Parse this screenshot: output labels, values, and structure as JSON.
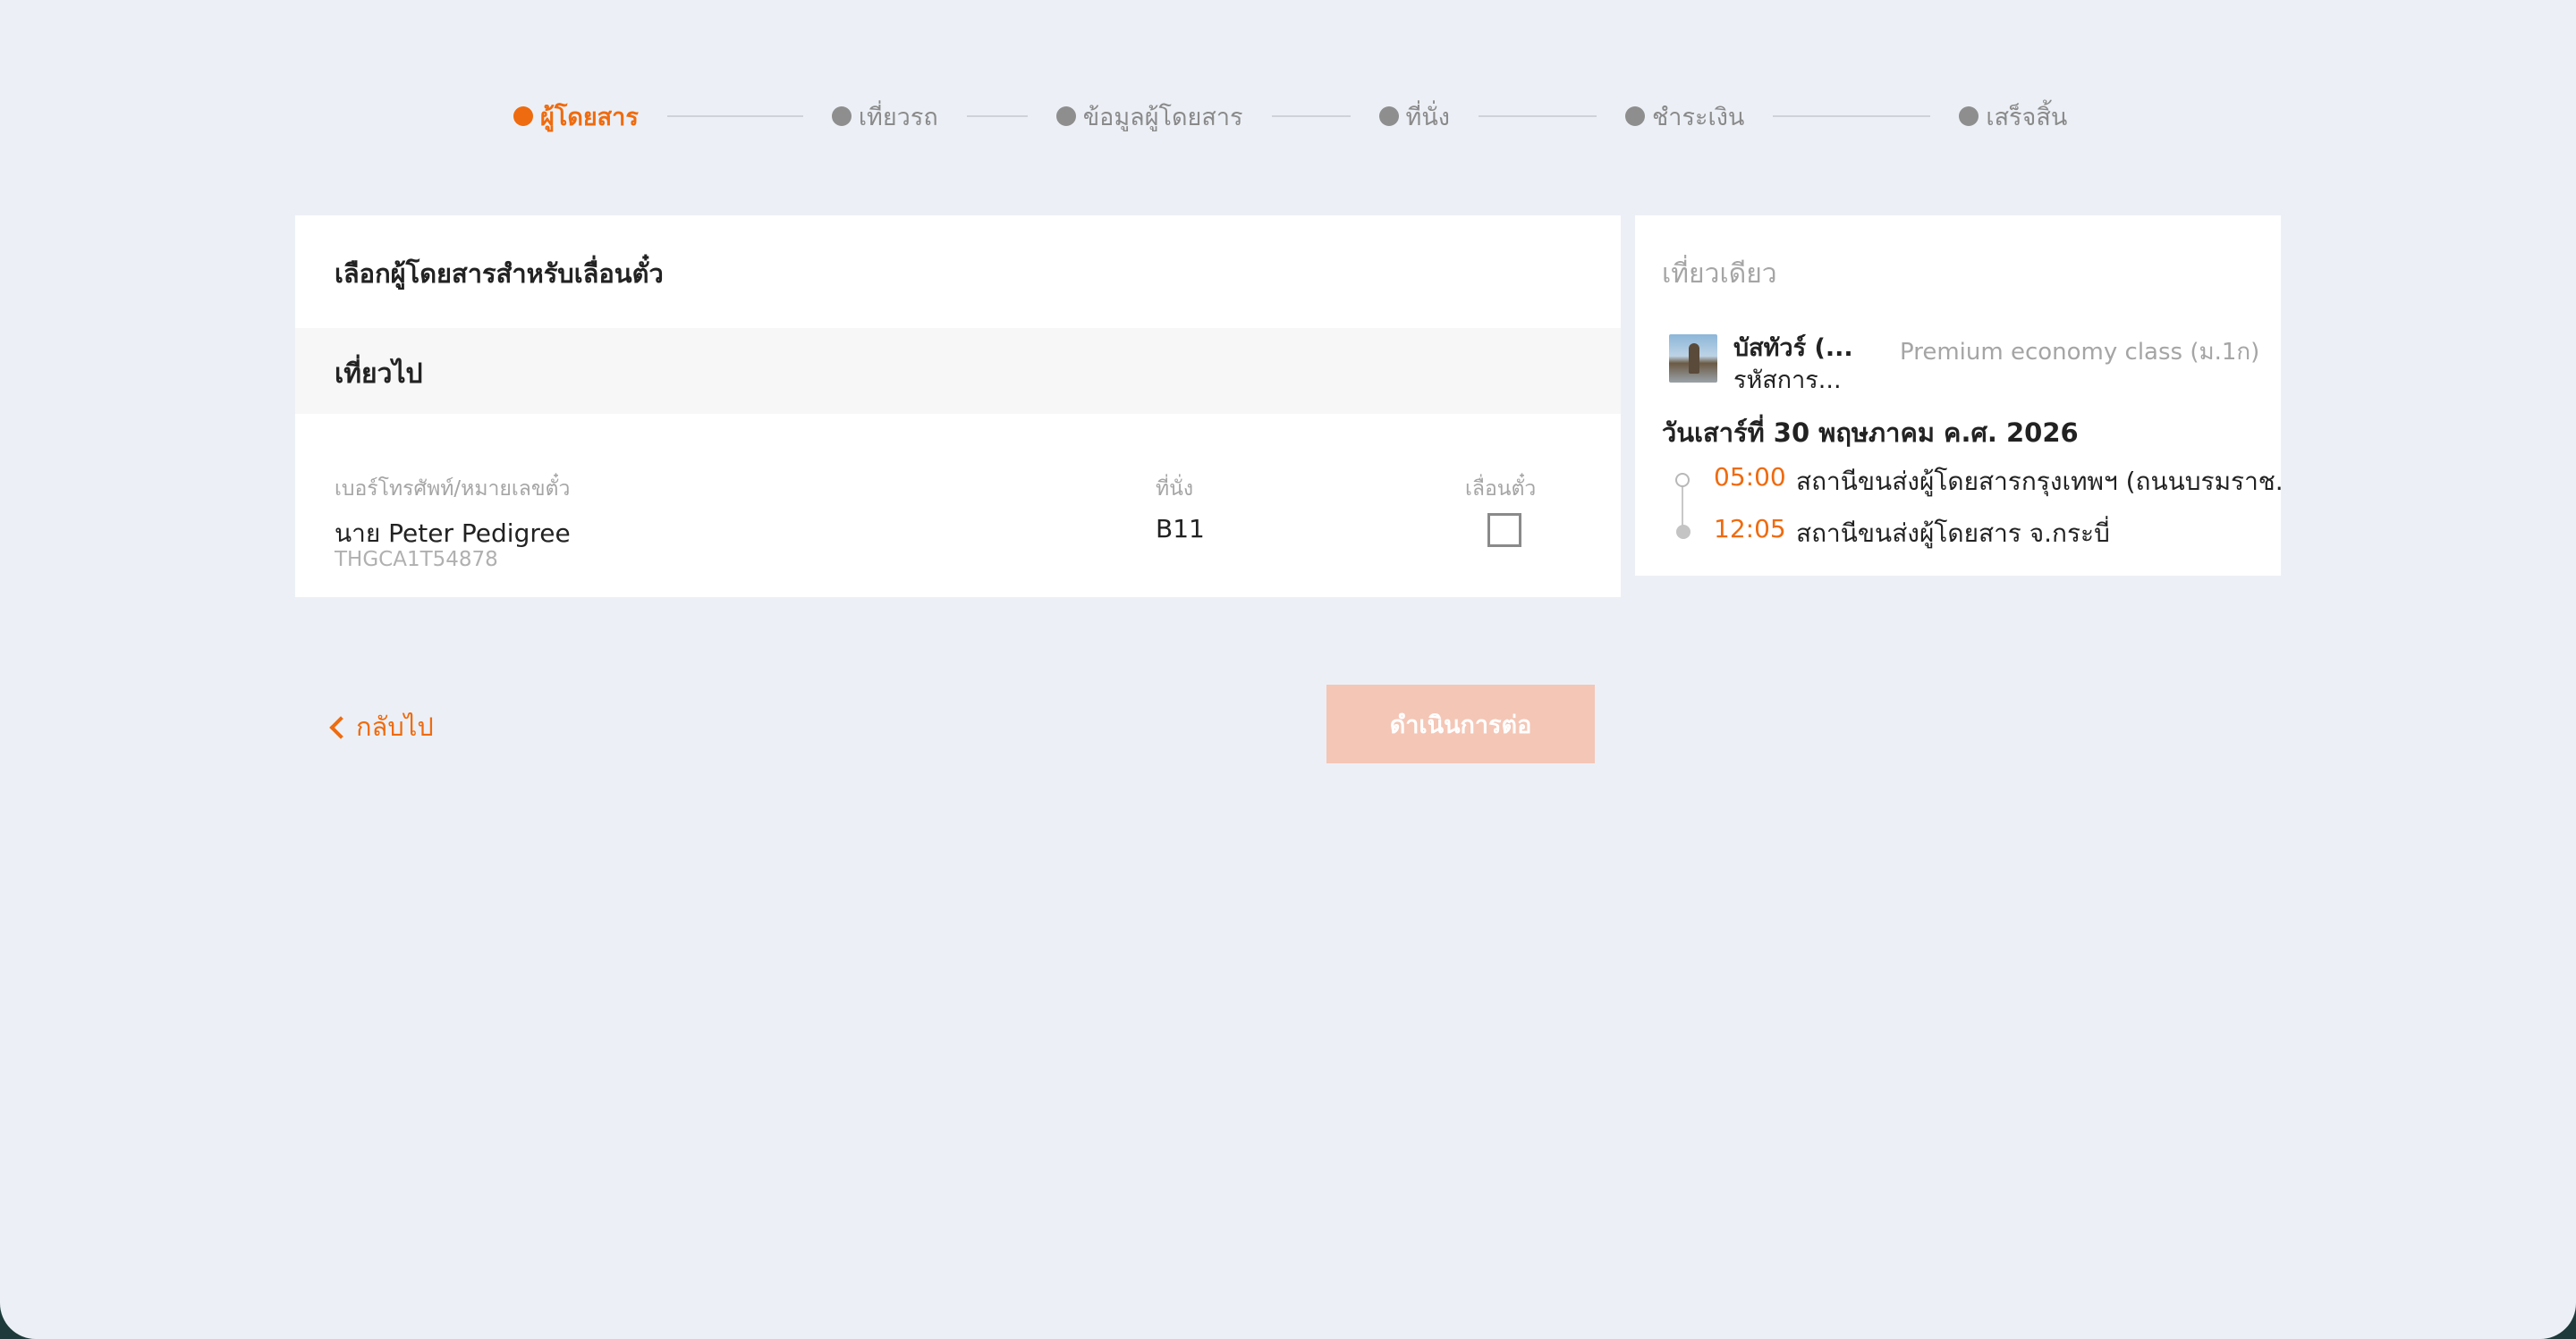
{
  "stepper": {
    "steps": [
      {
        "label": "ผู้โดยสาร",
        "active": true
      },
      {
        "label": "เที่ยวรถ",
        "active": false
      },
      {
        "label": "ข้อมูลผู้โดยสาร",
        "active": false
      },
      {
        "label": "ที่นั่ง",
        "active": false
      },
      {
        "label": "ชำระเงิน",
        "active": false
      },
      {
        "label": "เสร็จสิ้น",
        "active": false
      }
    ]
  },
  "left_card": {
    "title": "เลือกผู้โดยสารสำหรับเลื่อนตั๋ว",
    "section": "เที่ยวไป",
    "columns": {
      "passenger": "เบอร์โทรศัพท์/หมายเลขตั๋ว",
      "seat": "ที่นั่ง",
      "reschedule": "เลื่อนตั๋ว"
    },
    "row": {
      "name": "นาย Peter Pedigree",
      "ticket_code": "THGCA1T54878",
      "seat": "B11",
      "checked": false
    }
  },
  "actions": {
    "back_label": "กลับไป",
    "continue_label": "ดำเนินการต่อ"
  },
  "right_card": {
    "trip_type": "เที่ยวเดียว",
    "operator_name": "บัสทัวร์ (...",
    "operator_code": "รหัสการ...",
    "bus_class": "Premium economy class (ม.1ก)",
    "date": "วันเสาร์ที่ 30 พฤษภาคม ค.ศ. 2026",
    "departure": {
      "time": "05:00",
      "station": "สถานีขนส่งผู้โดยสารกรุงเทพฯ (ถนนบรมราช.."
    },
    "arrival": {
      "time": "12:05",
      "station": "สถานีขนส่งผู้โดยสาร จ.กระบี่"
    }
  },
  "colors": {
    "accent": "#ef6b0f",
    "disabled_button": "#f4c6b6",
    "background": "#ecf0f6"
  }
}
